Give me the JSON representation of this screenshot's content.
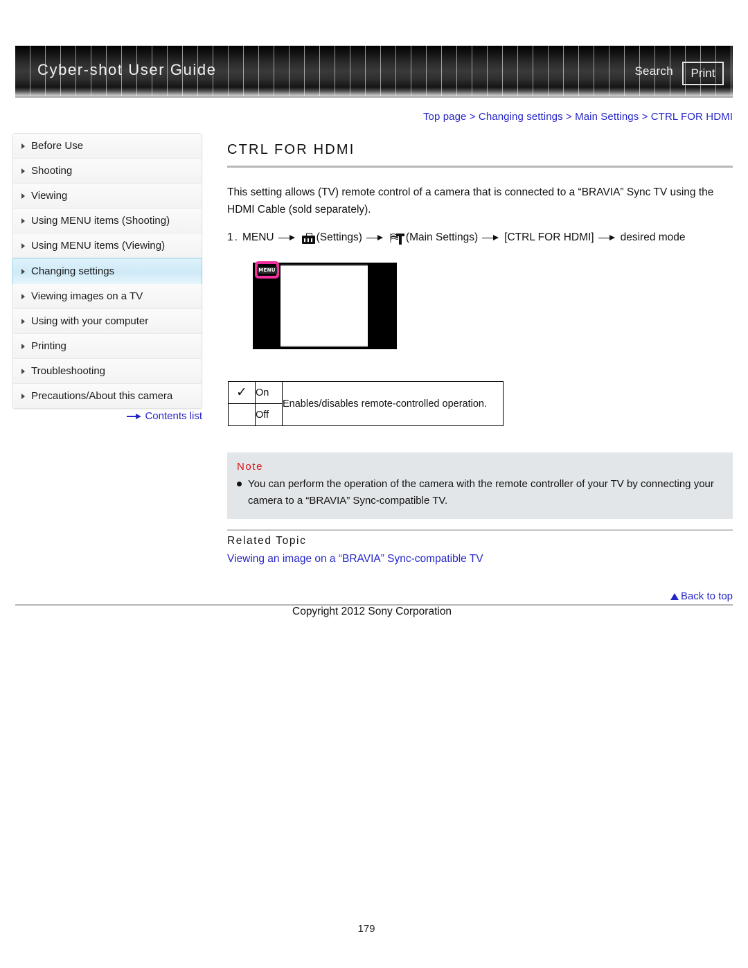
{
  "header": {
    "title": "Cyber-shot User Guide",
    "search_label": "Search",
    "print_label": "Print"
  },
  "breadcrumb": {
    "items": [
      "Top page",
      "Changing settings",
      "Main Settings",
      "CTRL FOR HDMI"
    ],
    "separator": ">",
    "full_text": "Top page > Changing settings > Main Settings > CTRL FOR HDMI",
    "color": "#2626c8"
  },
  "sidebar": {
    "items": [
      {
        "label": "Before Use",
        "active": false
      },
      {
        "label": "Shooting",
        "active": false
      },
      {
        "label": "Viewing",
        "active": false
      },
      {
        "label": "Using MENU items (Shooting)",
        "active": false
      },
      {
        "label": "Using MENU items (Viewing)",
        "active": false
      },
      {
        "label": "Changing settings",
        "active": true
      },
      {
        "label": "Viewing images on a TV",
        "active": false
      },
      {
        "label": "Using with your computer",
        "active": false
      },
      {
        "label": "Printing",
        "active": false
      },
      {
        "label": "Troubleshooting",
        "active": false
      },
      {
        "label": "Precautions/About this camera",
        "active": false
      }
    ],
    "contents_link": "Contents list",
    "active_color": "#cfeaf7"
  },
  "main": {
    "page_title": "CTRL FOR HDMI",
    "intro": "This setting allows (TV) remote control of a camera that is connected to a “BRAVIA” Sync TV using the HDMI Cable (sold separately).",
    "step": {
      "number": "1.",
      "part1": "MENU",
      "part2": "(Settings)",
      "part3": "(Main Settings)",
      "part4": "[CTRL FOR HDMI]",
      "part5": "desired mode"
    },
    "illustration": {
      "menu_button_label": "MENU",
      "highlight_color": "#f0309c"
    },
    "options_table": {
      "rows": [
        {
          "checked": "✓",
          "label": "On",
          "description": "Enables/disables remote-controlled operation."
        },
        {
          "checked": "",
          "label": "Off",
          "description": ""
        }
      ]
    },
    "note": {
      "title": "Note",
      "items": [
        "You can perform the operation of the camera with the remote controller of your TV by connecting your camera to a “BRAVIA” Sync-compatible TV."
      ],
      "title_color": "#d81212"
    },
    "related": {
      "heading": "Related Topic",
      "links": [
        "Viewing an image on a “BRAVIA” Sync-compatible TV"
      ]
    }
  },
  "footer": {
    "back_to_top": "Back to top",
    "copyright": "Copyright 2012 Sony Corporation",
    "page_number": "179"
  }
}
